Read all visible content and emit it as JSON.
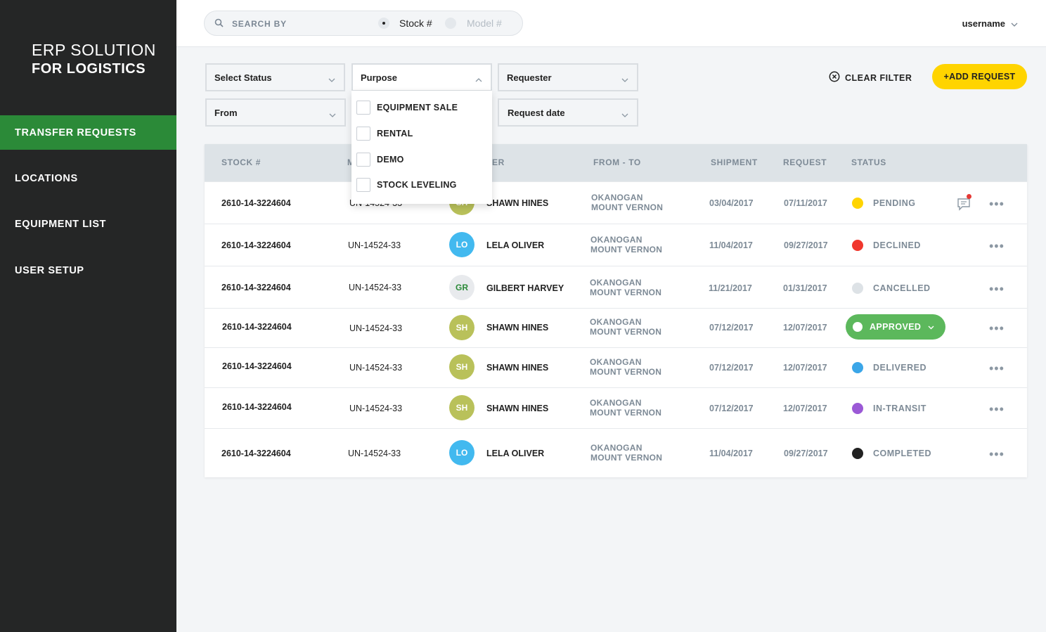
{
  "brand": {
    "line1": "ERP SOLUTION",
    "line2": "FOR LOGISTICS"
  },
  "sidebar": {
    "items": [
      {
        "label": "TRANSFER REQUESTS",
        "active": true
      },
      {
        "label": "LOCATIONS"
      },
      {
        "label": "EQUIPMENT LIST"
      },
      {
        "label": "USER SETUP"
      }
    ]
  },
  "search": {
    "label": "SEARCH BY",
    "options": [
      "Stock #",
      "Model #"
    ],
    "selected": "Stock #"
  },
  "user": {
    "name": "username"
  },
  "filters": {
    "status": "Select Status",
    "purpose": "Purpose",
    "requester": "Requester",
    "from": "From",
    "request_date": "Request date"
  },
  "purpose_options": [
    "EQUIPMENT SALE",
    "RENTAL",
    "DEMO",
    "STOCK LEVELING"
  ],
  "actions": {
    "clear_filter": "CLEAR FILTER",
    "add_request": "+ADD REQUEST"
  },
  "table": {
    "headers": {
      "stock": "STOCK #",
      "model": "M",
      "requester": "ER",
      "from_to": "FROM - TO",
      "shipment": "SHIPMENT",
      "request": "REQUEST",
      "status": "STATUS"
    },
    "rows": [
      {
        "stock": "2610-14-3224604",
        "model": "UN-14524-33",
        "initials": "SH",
        "name": "SHAWN HINES",
        "from": "OKANOGAN",
        "to": "MOUNT VERNON",
        "shipment": "03/04/2017",
        "request": "07/11/2017",
        "status": "PENDING"
      },
      {
        "stock": "2610-14-3224604",
        "model": "UN-14524-33",
        "initials": "LO",
        "name": "LELA OLIVER",
        "from": "OKANOGAN",
        "to": "MOUNT VERNON",
        "shipment": "11/04/2017",
        "request": "09/27/2017",
        "status": "DECLINED"
      },
      {
        "stock": "2610-14-3224604",
        "model": "UN-14524-33",
        "initials": "GR",
        "name": "GILBERT HARVEY",
        "from": "OKANOGAN",
        "to": "MOUNT VERNON",
        "shipment": "11/21/2017",
        "request": "01/31/2017",
        "status": "CANCELLED"
      },
      {
        "stock": "2610-14-3224604",
        "model": "UN-14524-33",
        "initials": "SH",
        "name": "SHAWN HINES",
        "from": "OKANOGAN",
        "to": "MOUNT VERNON",
        "shipment": "07/12/2017",
        "request": "12/07/2017",
        "status": "APPROVED"
      },
      {
        "stock": "2610-14-3224604",
        "model": "UN-14524-33",
        "initials": "SH",
        "name": "SHAWN HINES",
        "from": "OKANOGAN",
        "to": "MOUNT VERNON",
        "shipment": "07/12/2017",
        "request": "12/07/2017",
        "status": "DELIVERED"
      },
      {
        "stock": "2610-14-3224604",
        "model": "UN-14524-33",
        "initials": "SH",
        "name": "SHAWN HINES",
        "from": "OKANOGAN",
        "to": "MOUNT VERNON",
        "shipment": "07/12/2017",
        "request": "12/07/2017",
        "status": "IN-TRANSIT"
      },
      {
        "stock": "2610-14-3224604",
        "model": "UN-14524-33",
        "initials": "LO",
        "name": "LELA OLIVER",
        "from": "OKANOGAN",
        "to": "MOUNT VERNON",
        "shipment": "11/04/2017",
        "request": "09/27/2017",
        "status": "COMPLETED"
      }
    ]
  },
  "colors": {
    "sidebar_bg": "#252626",
    "active_nav": "#2b8a38",
    "accent_yellow": "#ffd400",
    "avatar_sh": "#b9c15a",
    "avatar_lo": "#42b9ef",
    "avatar_gr": "#e8eaed",
    "pending": "#ffd400",
    "declined": "#f0372d",
    "cancelled": "#dde2e6",
    "approved": "#5cb85c",
    "delivered": "#3ba6e8",
    "in_transit": "#9b59d6",
    "completed": "#222222"
  },
  "icons": [
    "search-icon",
    "chevron-down-icon",
    "clear-filter-icon",
    "message-icon",
    "more-icon"
  ]
}
